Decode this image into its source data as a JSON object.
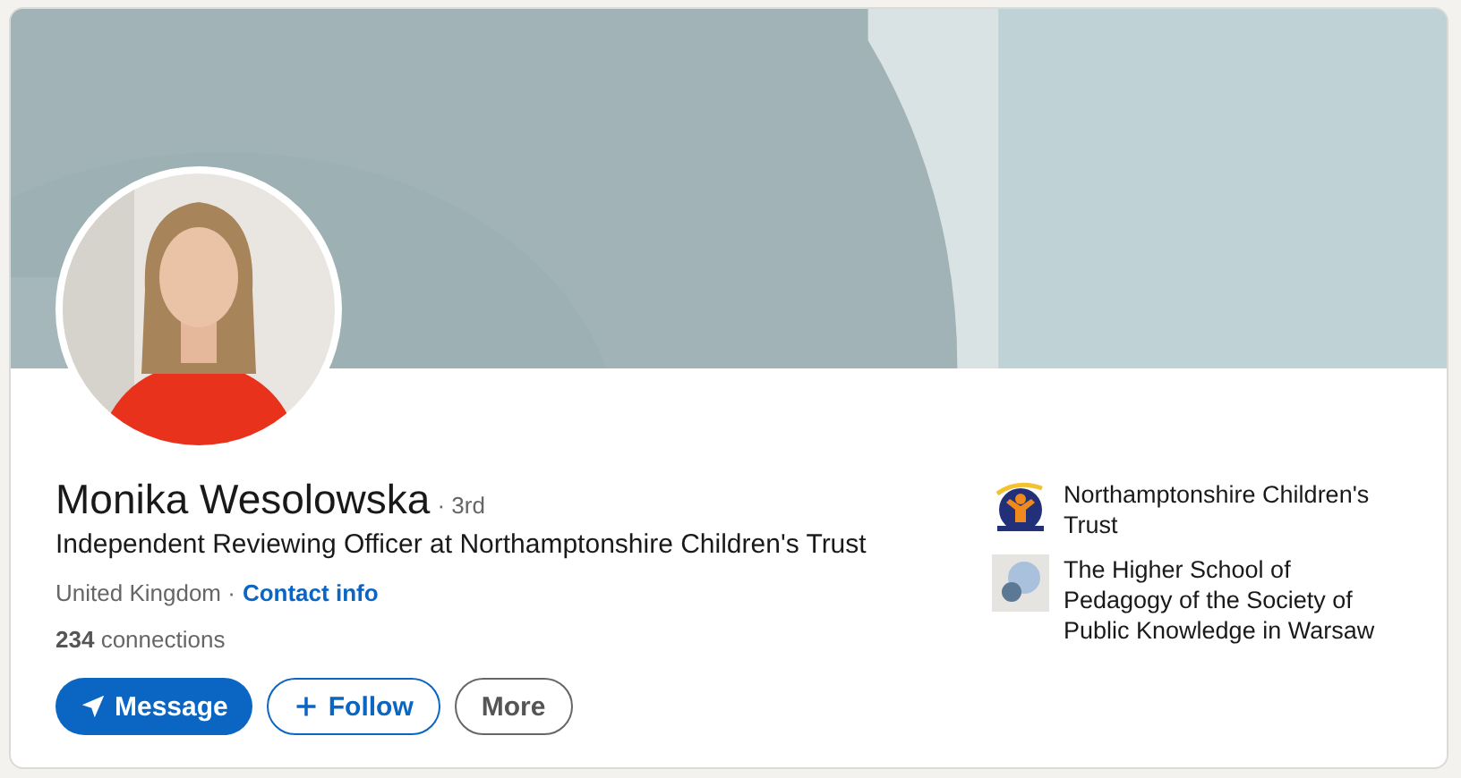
{
  "profile": {
    "name": "Monika Wesolowska",
    "degree": "· 3rd",
    "headline": "Independent Reviewing Officer at Northamptonshire Children's Trust",
    "location": "United Kingdom ·",
    "contact_link": "Contact info",
    "connections": "**234** connections"
  },
  "actions": [
    {
      "label": "Message",
      "kind": "message"
    },
    {
      "label": "Follow",
      "kind": "follow"
    },
    {
      "label": "More",
      "kind": "more"
    }
  ],
  "organizations": [
    {
      "name": "Northamptonshire Children's Trust",
      "kind": "trust"
    },
    {
      "name": "The Higher School of Pedagogy of the Society of Public Knowledge in Warsaw",
      "kind": "school"
    }
  ]
}
